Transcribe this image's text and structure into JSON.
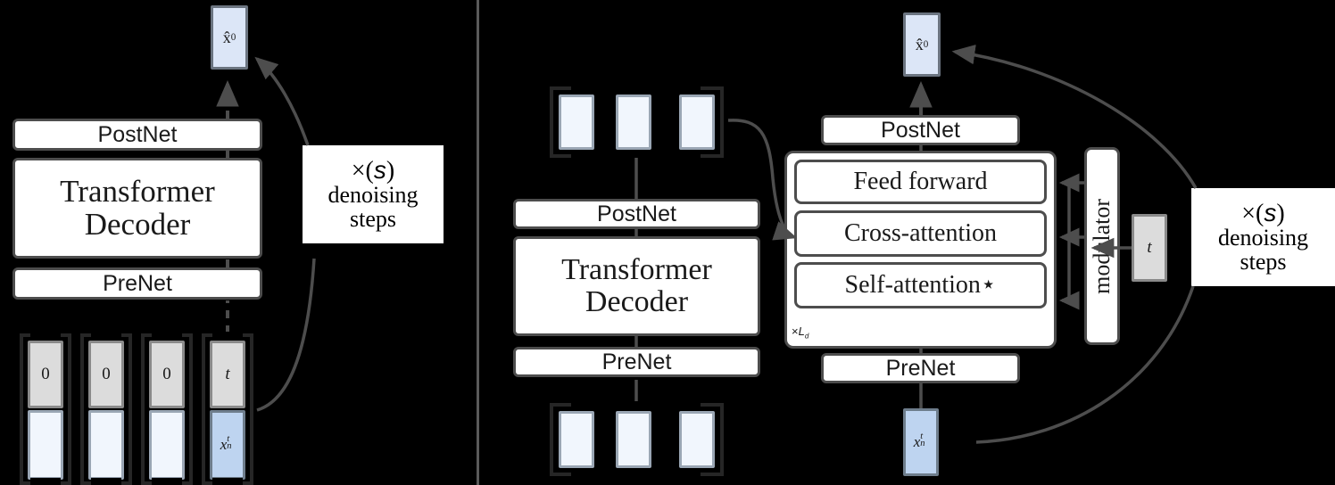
{
  "figure": {
    "background": "#000000",
    "divider_color": "#5a5a5a",
    "colors": {
      "module_fill": "#ffffff",
      "module_border": "#4d4d4d",
      "token_gray": "#dcdcdc",
      "token_pale_blue": "#f1f6fd",
      "token_blue": "#bed4f0",
      "output_blue": "#dce6f7",
      "arrow": "#4d4d4d"
    }
  },
  "left_panel": {
    "name": "non-autoregressive-denoising-decoder",
    "output_token": {
      "label": "x̂",
      "superscript": "0"
    },
    "stack": [
      {
        "id": "postnet",
        "label": "PostNet",
        "font": "sans"
      },
      {
        "id": "transformer-decoder",
        "label": "Transformer\nDecoder",
        "line1": "Transformer",
        "line2": "Decoder",
        "font": "serif"
      },
      {
        "id": "prenet",
        "label": "PreNet",
        "font": "sans"
      }
    ],
    "input_tokens": [
      {
        "top": "0",
        "bottom": "",
        "top_style": "gray",
        "bottom_style": "pale"
      },
      {
        "top": "0",
        "bottom": "",
        "top_style": "gray",
        "bottom_style": "pale"
      },
      {
        "top": "0",
        "bottom": "",
        "top_style": "gray",
        "bottom_style": "pale"
      },
      {
        "top": "t",
        "bottom": "x",
        "bottom_sub": "n",
        "bottom_sup": "t",
        "top_style": "gray",
        "bottom_style": "blue"
      }
    ],
    "note": {
      "line1_prefix": "×(",
      "line1_var": "s",
      "line1_suffix": ")",
      "line2": "denoising",
      "line3": "steps"
    }
  },
  "right_panel": {
    "name": "cross-attention-conditioned-denoising-decoder",
    "encoder": {
      "top_tokens": [
        "",
        "",
        ""
      ],
      "bottom_tokens": [
        "",
        "",
        ""
      ],
      "stack": [
        {
          "id": "postnet",
          "label": "PostNet",
          "font": "sans"
        },
        {
          "id": "transformer-decoder",
          "label": "Transformer Decoder",
          "line1": "Transformer",
          "line2": "Decoder",
          "font": "serif"
        },
        {
          "id": "prenet",
          "label": "PreNet",
          "font": "sans"
        }
      ]
    },
    "decoder": {
      "output_token": {
        "label": "x̂",
        "superscript": "0"
      },
      "postnet": "PostNet",
      "layers": [
        {
          "id": "feed-forward",
          "label": "Feed forward"
        },
        {
          "id": "cross-attention",
          "label": "Cross-attention"
        },
        {
          "id": "self-attention",
          "label": "Self-attention⋆"
        }
      ],
      "repeat_label": {
        "symbol": "×",
        "var": "L",
        "sub": "d"
      },
      "prenet": "PreNet",
      "input_token": {
        "label": "x",
        "sub": "n",
        "sup": "t"
      },
      "modulator": "modulator",
      "timestep_token": "t"
    },
    "note": {
      "line1_prefix": "×(",
      "line1_var": "s",
      "line1_suffix": ")",
      "line2": "denoising",
      "line3": "steps"
    }
  }
}
